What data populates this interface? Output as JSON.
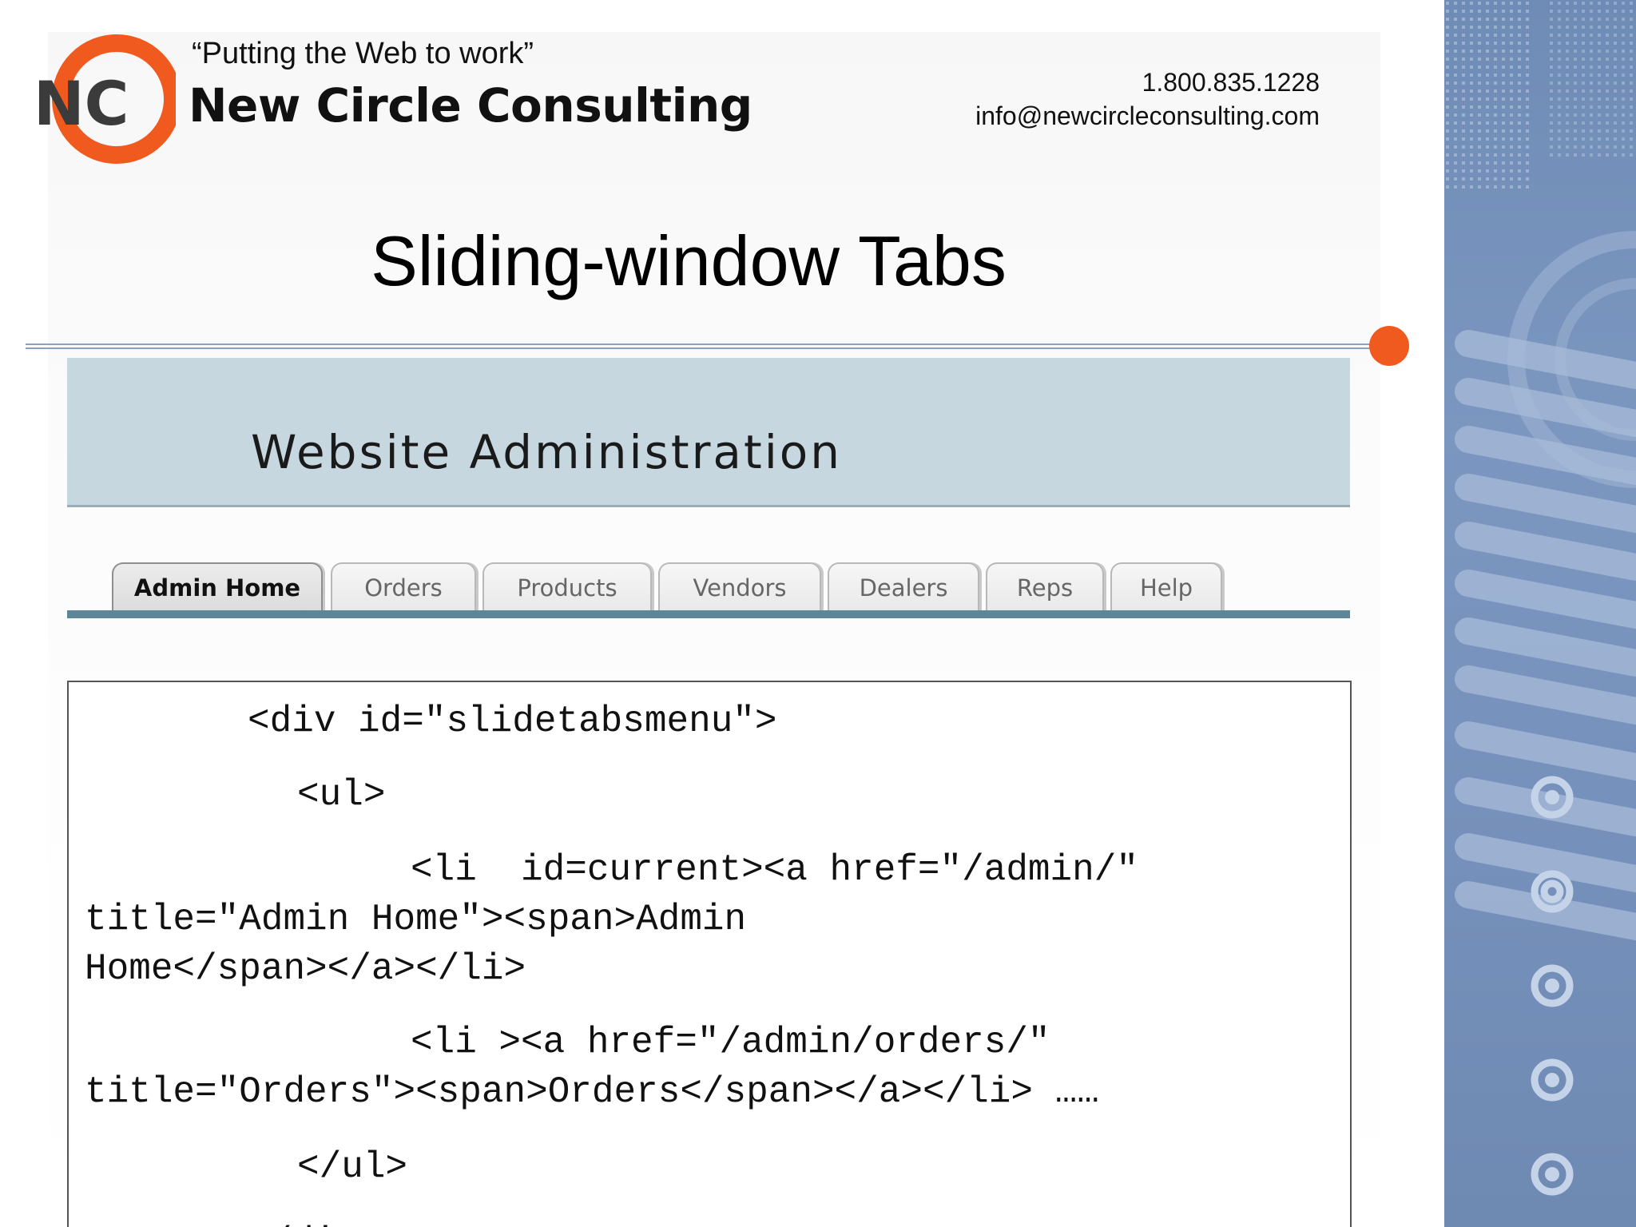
{
  "header": {
    "tagline": "“Putting the Web to work”",
    "company_name": "New Circle Consulting",
    "logo_initials": "NC",
    "phone": "1.800.835.1228",
    "email": "info@newcircleconsulting.com"
  },
  "slide": {
    "title": "Sliding-window Tabs"
  },
  "screenshot": {
    "banner_title": "Website Administration",
    "tabs": [
      {
        "label": "Admin Home",
        "current": true
      },
      {
        "label": "Orders",
        "current": false
      },
      {
        "label": "Products",
        "current": false
      },
      {
        "label": "Vendors",
        "current": false
      },
      {
        "label": "Dealers",
        "current": false
      },
      {
        "label": "Reps",
        "current": false
      },
      {
        "label": "Help",
        "current": false
      }
    ]
  },
  "code": {
    "lines": [
      "<div id=\"slidetabsmenu\">",
      "<ul>",
      "<li  id=current><a href=\"/admin/\"",
      "title=\"Admin Home\"><span>Admin",
      "Home</span></a></li>",
      "<li ><a href=\"/admin/orders/\"",
      "title=\"Orders\"><span>Orders</span></a></li> ……",
      "</ul>",
      "</div>"
    ]
  },
  "colors": {
    "accent_orange": "#f05a1e",
    "side_panel_blue": "#7590ba",
    "banner_blue": "#c6d7e0",
    "tab_baseline": "#5f8598"
  }
}
